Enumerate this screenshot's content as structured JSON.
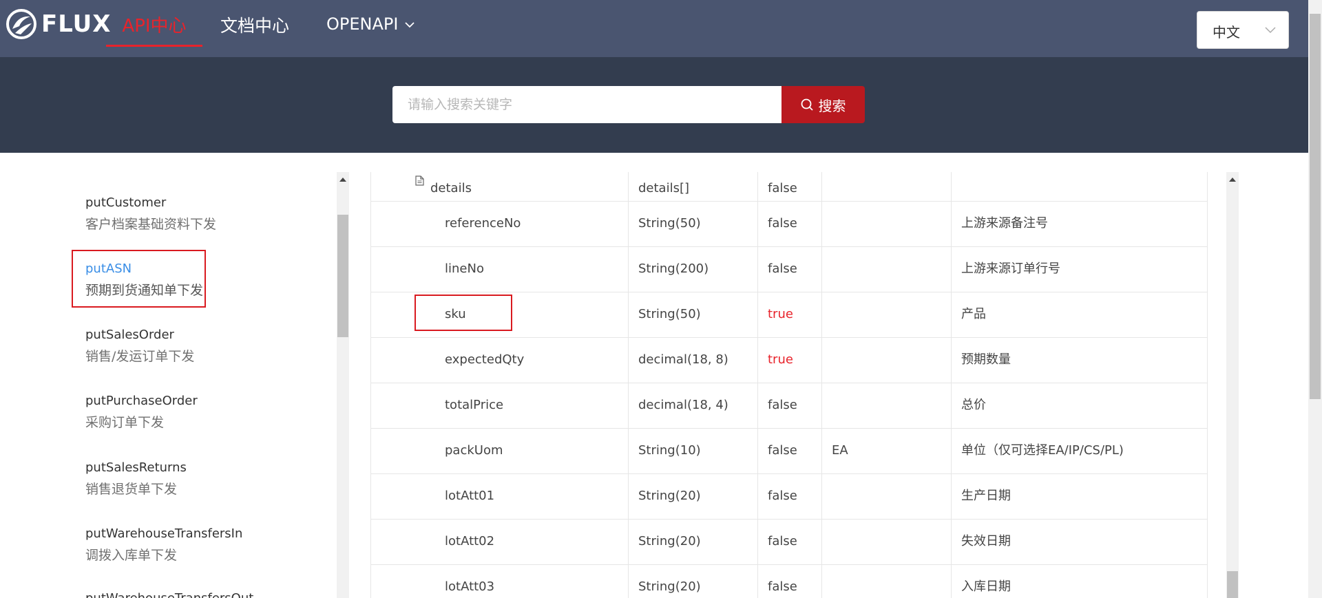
{
  "header": {
    "logo_text": "FLUX",
    "nav": {
      "api_center": "API中心",
      "doc_center": "文档中心",
      "openapi": "OPENAPI"
    },
    "language": "中文",
    "colors": {
      "nav_bg": "#4a5570",
      "accent": "#e8232b",
      "band_bg": "#333d4f",
      "search_btn": "#b9191f",
      "link_blue": "#3a8ee6"
    }
  },
  "search": {
    "placeholder": "请输入搜索关键字",
    "button_label": "搜索"
  },
  "sidebar": {
    "items": [
      {
        "name": "putCustomer",
        "desc": "客户档案基础资料下发"
      },
      {
        "name": "putASN",
        "desc": "预期到货通知单下发",
        "active": true
      },
      {
        "name": "putSalesOrder",
        "desc": "销售/发运订单下发"
      },
      {
        "name": "putPurchaseOrder",
        "desc": "采购订单下发"
      },
      {
        "name": "putSalesReturns",
        "desc": "销售退货单下发"
      },
      {
        "name": "putWarehouseTransfersIn",
        "desc": "调拨入库单下发"
      },
      {
        "name": "putWarehouseTransfersOut",
        "desc": ""
      }
    ]
  },
  "table": {
    "rows": [
      {
        "name": "details",
        "type": "details[]",
        "required": "false",
        "default": "",
        "desc": ""
      },
      {
        "name": "referenceNo",
        "type": "String(50)",
        "required": "false",
        "default": "",
        "desc": "上游来源备注号"
      },
      {
        "name": "lineNo",
        "type": "String(200)",
        "required": "false",
        "default": "",
        "desc": "上游来源订单行号"
      },
      {
        "name": "sku",
        "type": "String(50)",
        "required": "true",
        "default": "",
        "desc": "产品"
      },
      {
        "name": "expectedQty",
        "type": "decimal(18, 8)",
        "required": "true",
        "default": "",
        "desc": "预期数量"
      },
      {
        "name": "totalPrice",
        "type": "decimal(18, 4)",
        "required": "false",
        "default": "",
        "desc": "总价"
      },
      {
        "name": "packUom",
        "type": "String(10)",
        "required": "false",
        "default": "EA",
        "desc": "单位（仅可选择EA/IP/CS/PL)"
      },
      {
        "name": "lotAtt01",
        "type": "String(20)",
        "required": "false",
        "default": "",
        "desc": "生产日期"
      },
      {
        "name": "lotAtt02",
        "type": "String(20)",
        "required": "false",
        "default": "",
        "desc": "失效日期"
      },
      {
        "name": "lotAtt03",
        "type": "String(20)",
        "required": "false",
        "default": "",
        "desc": "入库日期"
      }
    ]
  }
}
